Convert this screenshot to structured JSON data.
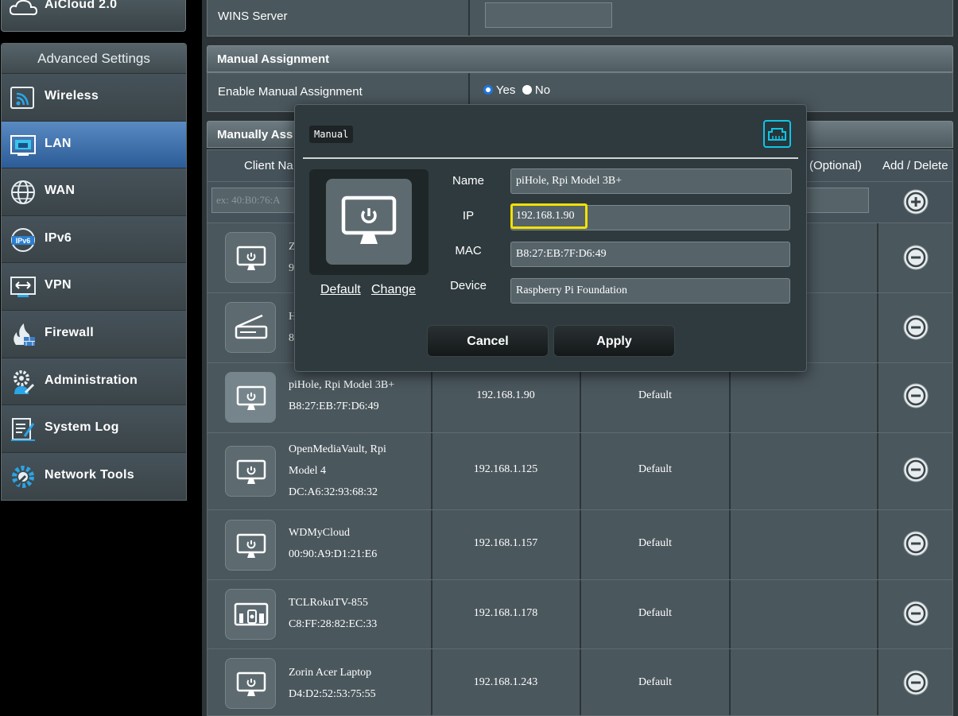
{
  "sidebar": {
    "top_item": "AiCloud 2.0",
    "heading": "Advanced Settings",
    "items": [
      {
        "label": "Wireless",
        "icon": "wireless-icon"
      },
      {
        "label": "LAN",
        "icon": "lan-icon",
        "active": true
      },
      {
        "label": "WAN",
        "icon": "globe-icon"
      },
      {
        "label": "IPv6",
        "icon": "ipv6-icon"
      },
      {
        "label": "VPN",
        "icon": "vpn-icon"
      },
      {
        "label": "Firewall",
        "icon": "firewall-icon"
      },
      {
        "label": "Administration",
        "icon": "administration-icon"
      },
      {
        "label": "System Log",
        "icon": "system-log-icon"
      },
      {
        "label": "Network Tools",
        "icon": "network-tools-icon"
      }
    ]
  },
  "main": {
    "wins_label": "WINS Server",
    "manual_title": "Manual Assignment",
    "enable_label": "Enable Manual Assignment",
    "radio_yes": "Yes",
    "radio_no": "No",
    "list_title": "Manually Assigned IP around the DHCP list",
    "list_title_visible": "Manually Ass",
    "col_client": "Client Na",
    "col_optional": "(Optional)",
    "col_add_delete": "Add / Delete",
    "mac_placeholder": "ex: 40:B0:76:A",
    "rows": [
      {
        "name1": "Z",
        "name2": "9",
        "ip": "",
        "host": "",
        "icon": "monitor-icon"
      },
      {
        "name1": "H",
        "name2": "8",
        "ip": "",
        "host": "",
        "icon": "scanner-icon"
      },
      {
        "name1": "piHole, Rpi Model 3B+",
        "name2": "B8:27:EB:7F:D6:49",
        "ip": "192.168.1.90",
        "host": "Default",
        "icon": "monitor-icon"
      },
      {
        "name1": "OpenMediaVault, Rpi",
        "name2": "Model 4",
        "name3": "DC:A6:32:93:68:32",
        "ip": "192.168.1.125",
        "host": "Default",
        "icon": "monitor-icon"
      },
      {
        "name1": "WDMyCloud",
        "name2": "00:90:A9:D1:21:E6",
        "ip": "192.168.1.157",
        "host": "Default",
        "icon": "monitor-icon"
      },
      {
        "name1": "TCLRokuTV-855",
        "name2": "C8:FF:28:82:EC:33",
        "ip": "192.168.1.178",
        "host": "Default",
        "icon": "tv-device-icon"
      },
      {
        "name1": "Zorin Acer Laptop",
        "name2": "D4:D2:52:53:75:55",
        "ip": "192.168.1.243",
        "host": "Default",
        "icon": "monitor-icon"
      }
    ]
  },
  "modal": {
    "title": "Manual",
    "link_default": "Default",
    "link_change": "Change",
    "name_label": "Name",
    "name_value": "piHole, Rpi Model 3B+",
    "ip_label": "IP",
    "ip_value": "192.168.1.90",
    "mac_label": "MAC",
    "mac_value": "B8:27:EB:7F:D6:49",
    "device_label": "Device",
    "device_value": "Raspberry Pi Foundation",
    "cancel": "Cancel",
    "apply": "Apply"
  },
  "colors": {
    "accent_active": "#2b5c97",
    "highlight": "#f3e100",
    "lan_icon": "#12c4e6"
  }
}
